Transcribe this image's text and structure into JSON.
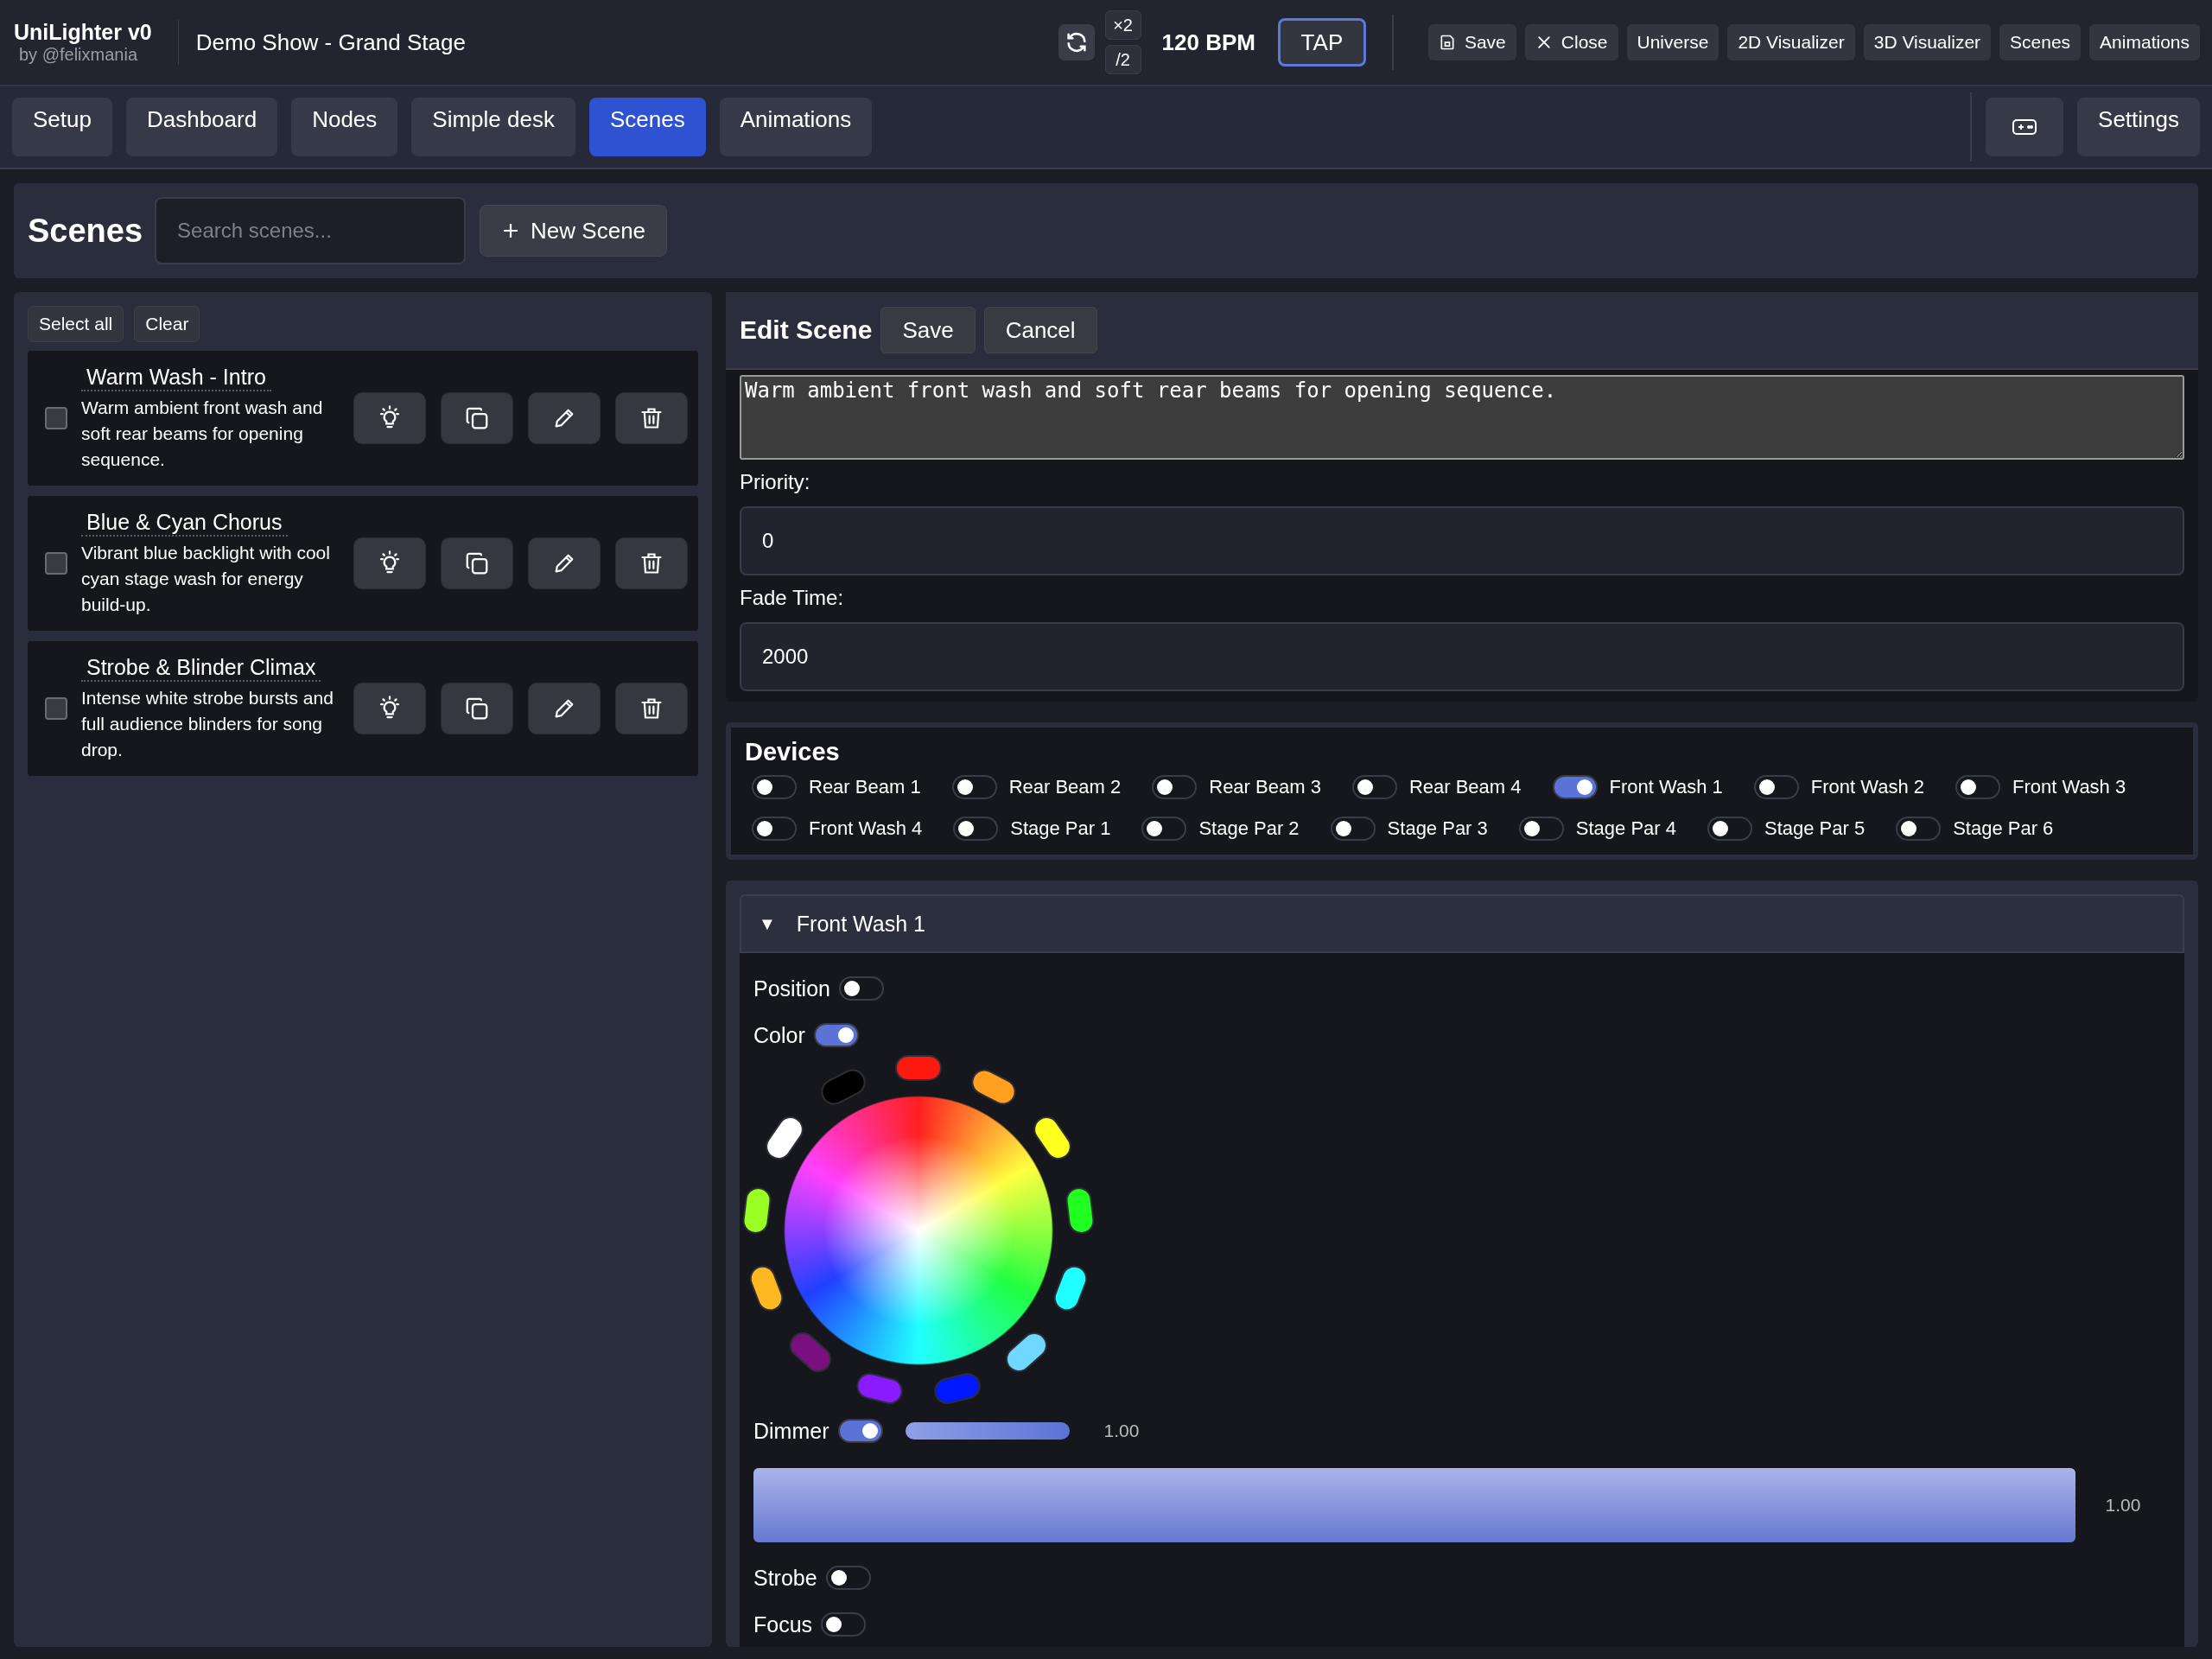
{
  "header": {
    "app_name": "UniLighter v0",
    "byline": "by @felixmania",
    "show_name": "Demo Show - Grand Stage",
    "multiply": "×2",
    "divide": "/2",
    "bpm": "120 BPM",
    "tap": "TAP",
    "buttons": [
      {
        "label": "Save",
        "kind": "save"
      },
      {
        "label": "Close",
        "kind": "close"
      },
      {
        "label": "Universe",
        "kind": "plain"
      },
      {
        "label": "2D Visualizer",
        "kind": "plain"
      },
      {
        "label": "3D Visualizer",
        "kind": "plain"
      },
      {
        "label": "Scenes",
        "kind": "plain"
      },
      {
        "label": "Animations",
        "kind": "plain"
      }
    ]
  },
  "tabs": [
    {
      "label": "Setup",
      "selected": false
    },
    {
      "label": "Dashboard",
      "selected": false
    },
    {
      "label": "Nodes",
      "selected": false
    },
    {
      "label": "Simple desk",
      "selected": false
    },
    {
      "label": "Scenes",
      "selected": true
    },
    {
      "label": "Animations",
      "selected": false
    }
  ],
  "settings": "Settings",
  "scenes_header": {
    "title": "Scenes",
    "search_placeholder": "Search scenes...",
    "new_button": "New Scene"
  },
  "scene_list": {
    "select_all": "Select all",
    "clear": "Clear",
    "items": [
      {
        "name": "Warm Wash - Intro",
        "description": "Warm ambient front wash and soft rear beams for opening sequence.",
        "checked": false
      },
      {
        "name": "Blue & Cyan Chorus",
        "description": "Vibrant blue backlight with cool cyan stage wash for energy build-up.",
        "checked": false
      },
      {
        "name": "Strobe & Blinder Climax",
        "description": "Intense white strobe bursts and full audience blinders for song drop.",
        "checked": false
      }
    ]
  },
  "edit_scene": {
    "title": "Edit Scene",
    "save": "Save",
    "cancel": "Cancel",
    "description": "Warm ambient front wash and soft rear beams for opening sequence.",
    "priority_label": "Priority:",
    "priority": "0",
    "fade_label": "Fade Time:",
    "fade": "2000"
  },
  "devices": {
    "title": "Devices",
    "items": [
      {
        "name": "Rear Beam 1",
        "on": false
      },
      {
        "name": "Rear Beam 2",
        "on": false
      },
      {
        "name": "Rear Beam 3",
        "on": false
      },
      {
        "name": "Rear Beam 4",
        "on": false
      },
      {
        "name": "Front Wash 1",
        "on": true
      },
      {
        "name": "Front Wash 2",
        "on": false
      },
      {
        "name": "Front Wash 3",
        "on": false
      },
      {
        "name": "Front Wash 4",
        "on": false
      },
      {
        "name": "Stage Par 1",
        "on": false
      },
      {
        "name": "Stage Par 2",
        "on": false
      },
      {
        "name": "Stage Par 3",
        "on": false
      },
      {
        "name": "Stage Par 4",
        "on": false
      },
      {
        "name": "Stage Par 5",
        "on": false
      },
      {
        "name": "Stage Par 6",
        "on": false
      }
    ]
  },
  "fixture": {
    "toggle": "▼",
    "name": "Front Wash 1",
    "expanded": true,
    "channels": [
      {
        "kind": "toggle",
        "label": "Position",
        "on": false
      },
      {
        "kind": "color",
        "label": "Color",
        "on": true,
        "presets": [
          {
            "color": "#ff1a0f"
          },
          {
            "color": "#ffa020"
          },
          {
            "color": "#ffff20"
          },
          {
            "color": "#20ff20"
          },
          {
            "color": "#20ffff"
          },
          {
            "color": "#70d8ff"
          },
          {
            "color": "#0018ff"
          },
          {
            "color": "#8a1aff"
          },
          {
            "color": "#7a1080"
          },
          {
            "color": "#ffb820"
          },
          {
            "color": "#99ff22"
          },
          {
            "color": "#ffffff"
          },
          {
            "color": "#000000"
          }
        ]
      },
      {
        "kind": "dimmer",
        "label": "Dimmer",
        "on": true,
        "mini": {
          "level": 1,
          "reading": "1.00"
        },
        "slider": {
          "level": 1,
          "reading": "1.00"
        }
      },
      {
        "kind": "toggle",
        "label": "Strobe",
        "on": false
      },
      {
        "kind": "toggle",
        "label": "Focus",
        "on": false
      }
    ]
  }
}
